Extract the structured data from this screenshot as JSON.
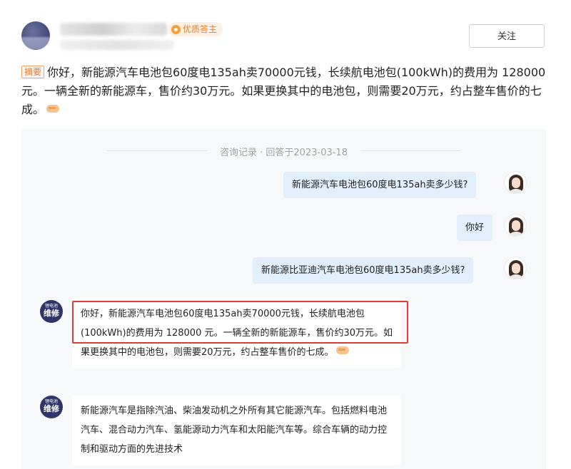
{
  "header": {
    "badge_label": "优质答主",
    "follow_label": "关注"
  },
  "summary": {
    "tag": "摘要",
    "text": "你好，新能源汽车电池包60度电135ah卖70000元钱，长续航电池包(100kWh)的费用为 128000 元。一辆全新的新能源车，售价约30万元。如果更换其中的电池包，则需要20万元，约占整车售价的七成。"
  },
  "consult": {
    "divider_text": "咨询记录 · 回答于2023-03-18",
    "messages": [
      {
        "role": "user",
        "text": "新能源汽车电池包60度电135ah卖多少钱?"
      },
      {
        "role": "user",
        "text": "你好"
      },
      {
        "role": "user",
        "text": "新能源比亚迪汽车电池包60度电135ah卖多少钱?"
      },
      {
        "role": "bot",
        "text": "你好，新能源汽车电池包60度电135ah卖70000元钱，长续航电池包(100kWh)的费用为 128000 元。一辆全新的新能源车，售价约30万元。如果更换其中的电池包，则需要20万元，约占整车售价的七成。"
      },
      {
        "role": "bot",
        "text": "新能源汽车是指除汽油、柴油发动机之外所有其它能源汽车。包括燃料电池汽车、混合动力汽车、氢能源动力汽车和太阳能汽车等。综合车辆的动力控制和驱动方面的先进技术"
      }
    ],
    "bot_avatar_top": "锂电池",
    "bot_avatar_main": "维修"
  },
  "colors": {
    "highlight": "#e03b35",
    "user_bubble": "#e0effb",
    "accent_tag": "#e2783a"
  }
}
